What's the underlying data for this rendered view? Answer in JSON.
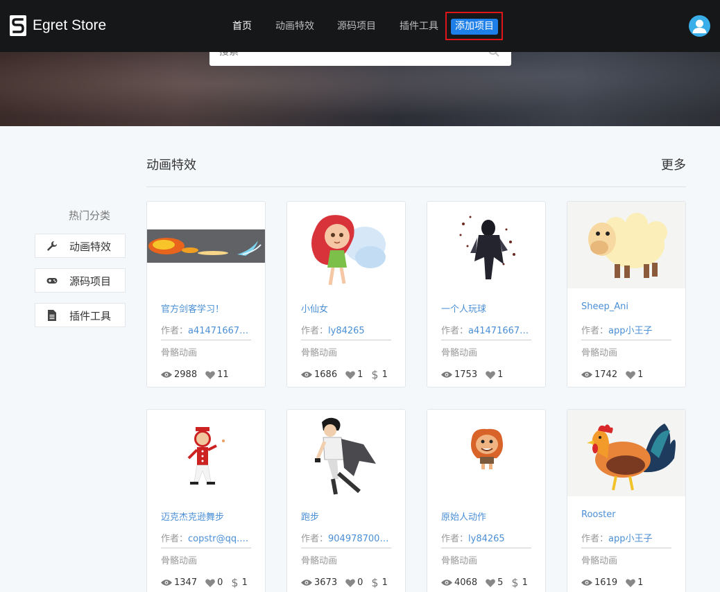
{
  "nav": {
    "brand": "Egret Store",
    "items": [
      {
        "label": "首页",
        "active": true
      },
      {
        "label": "动画特效",
        "active": false
      },
      {
        "label": "源码项目",
        "active": false
      },
      {
        "label": "插件工具",
        "active": false
      }
    ],
    "add_button": "添加项目"
  },
  "search": {
    "placeholder": "搜索"
  },
  "sidebar": {
    "title": "热门分类",
    "items": [
      {
        "label": "动画特效",
        "icon": "wrench-icon"
      },
      {
        "label": "源码项目",
        "icon": "gamepad-icon"
      },
      {
        "label": "插件工具",
        "icon": "file-icon"
      }
    ]
  },
  "section": {
    "title": "动画特效",
    "more": "更多"
  },
  "cards": [
    {
      "title": "官方剑客学习！",
      "author_label": "作者：",
      "author": "a41471667…",
      "category": "骨骼动画",
      "views": "2988",
      "likes": "11",
      "price": null
    },
    {
      "title": "小仙女",
      "author_label": "作者：",
      "author": "ly84265",
      "category": "骨骼动画",
      "views": "1686",
      "likes": "1",
      "price": "1"
    },
    {
      "title": "一个人玩球",
      "author_label": "作者：",
      "author": "a41471667…",
      "category": "骨骼动画",
      "views": "1753",
      "likes": "1",
      "price": null
    },
    {
      "title": "Sheep_Ani",
      "author_label": "作者：",
      "author": "app小王子",
      "category": "骨骼动画",
      "views": "1742",
      "likes": "1",
      "price": null
    },
    {
      "title": "迈克杰克逊舞步",
      "author_label": "作者：",
      "author": "copstr@qq.…",
      "category": "骨骼动画",
      "views": "1347",
      "likes": "0",
      "price": "1"
    },
    {
      "title": "跑步",
      "author_label": "作者：",
      "author": "904978700…",
      "category": "骨骼动画",
      "views": "3673",
      "likes": "0",
      "price": "1"
    },
    {
      "title": "原始人动作",
      "author_label": "作者：",
      "author": "ly84265",
      "category": "骨骼动画",
      "views": "4068",
      "likes": "5",
      "price": "1"
    },
    {
      "title": "Rooster",
      "author_label": "作者：",
      "author": "app小王子",
      "category": "骨骼动画",
      "views": "1619",
      "likes": "1",
      "price": null
    }
  ],
  "colors": {
    "nav_bg": "#161719",
    "accent": "#1e7fe8",
    "highlight_border": "#e0151a",
    "link": "#4a8fd6"
  }
}
